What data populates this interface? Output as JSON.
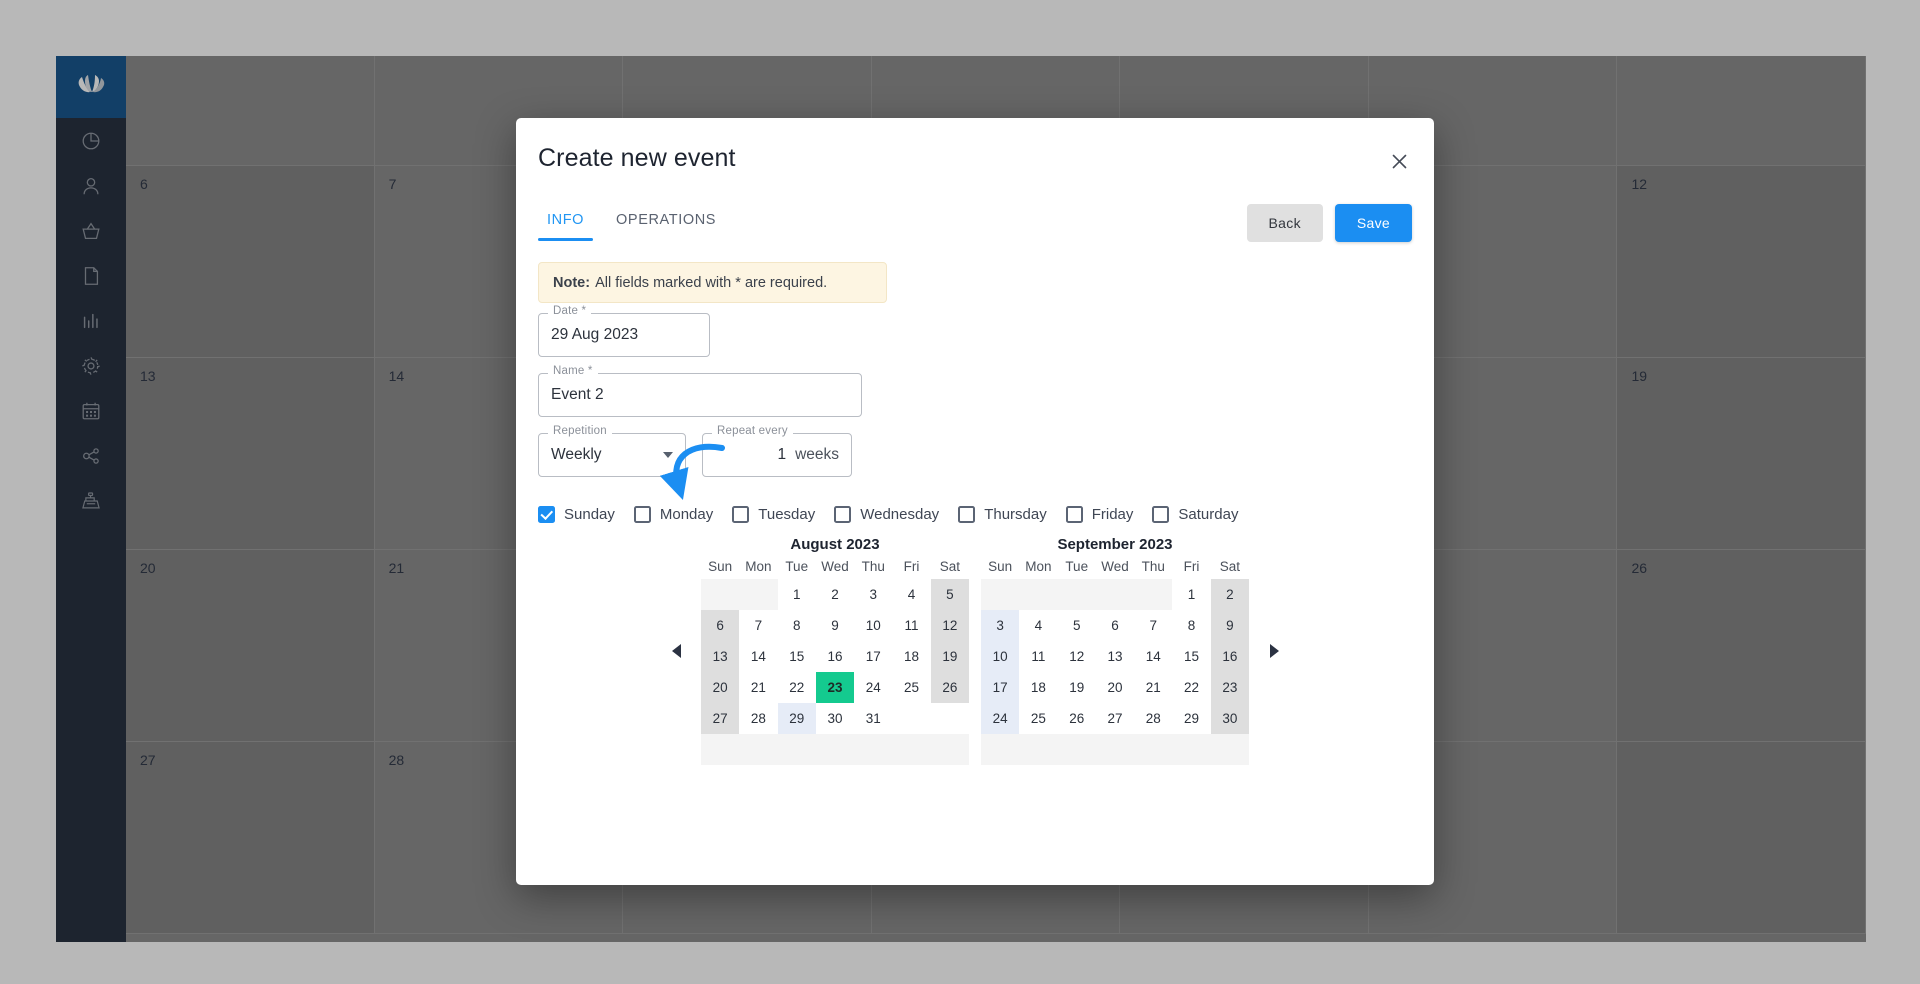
{
  "app": {
    "sidebar_items": [
      {
        "name": "logo",
        "icon": "leaf-logo-icon"
      },
      {
        "name": "dashboard",
        "icon": "pie-chart-icon"
      },
      {
        "name": "customers",
        "icon": "user-icon"
      },
      {
        "name": "orders",
        "icon": "basket-icon"
      },
      {
        "name": "documents",
        "icon": "document-icon"
      },
      {
        "name": "reports",
        "icon": "bar-chart-icon"
      },
      {
        "name": "settings",
        "icon": "gear-icon"
      },
      {
        "name": "calendar",
        "icon": "calendar-icon"
      },
      {
        "name": "integrations",
        "icon": "share-nodes-icon"
      },
      {
        "name": "register",
        "icon": "cash-register-icon"
      }
    ],
    "background_calendar": {
      "rows": [
        [
          "",
          "",
          "",
          "",
          "",
          "",
          ""
        ],
        [
          "6",
          "7",
          "",
          "",
          "",
          "",
          "12"
        ],
        [
          "13",
          "14",
          "",
          "",
          "",
          "",
          "19"
        ],
        [
          "20",
          "21",
          "",
          "",
          "",
          "",
          "26"
        ],
        [
          "27",
          "28",
          "",
          "",
          "",
          "",
          ""
        ]
      ]
    }
  },
  "modal": {
    "title": "Create new event",
    "close_label": "×",
    "tabs": [
      {
        "label": "INFO",
        "active": true
      },
      {
        "label": "OPERATIONS",
        "active": false
      }
    ],
    "buttons": {
      "back_label": "Back",
      "save_label": "Save"
    },
    "note": {
      "prefix": "Note:",
      "text": "All fields marked with * are required."
    },
    "fields": {
      "date": {
        "label": "Date *",
        "value": "29 Aug 2023"
      },
      "name": {
        "label": "Name *",
        "value": "Event 2"
      },
      "repetition": {
        "label": "Repetition",
        "value": "Weekly"
      },
      "repeat_every": {
        "label": "Repeat every",
        "value": "1",
        "unit": "weeks"
      }
    },
    "weekdays": [
      {
        "label": "Sunday",
        "checked": true
      },
      {
        "label": "Monday",
        "checked": false
      },
      {
        "label": "Tuesday",
        "checked": false
      },
      {
        "label": "Wednesday",
        "checked": false
      },
      {
        "label": "Thursday",
        "checked": false
      },
      {
        "label": "Friday",
        "checked": false
      },
      {
        "label": "Saturday",
        "checked": false
      }
    ],
    "calendars": {
      "prev_arrow": "prev-month-arrow",
      "next_arrow": "next-month-arrow",
      "day_headers": [
        "Sun",
        "Mon",
        "Tue",
        "Wed",
        "Thu",
        "Fri",
        "Sat"
      ],
      "months": [
        {
          "title": "August 2023",
          "weeks": [
            [
              {
                "d": "",
                "s": "pad"
              },
              {
                "d": "",
                "s": "pad"
              },
              {
                "d": "1",
                "s": ""
              },
              {
                "d": "2",
                "s": ""
              },
              {
                "d": "3",
                "s": ""
              },
              {
                "d": "4",
                "s": ""
              },
              {
                "d": "5",
                "s": "wk"
              }
            ],
            [
              {
                "d": "6",
                "s": "wk"
              },
              {
                "d": "7",
                "s": ""
              },
              {
                "d": "8",
                "s": ""
              },
              {
                "d": "9",
                "s": ""
              },
              {
                "d": "10",
                "s": ""
              },
              {
                "d": "11",
                "s": ""
              },
              {
                "d": "12",
                "s": "wk"
              }
            ],
            [
              {
                "d": "13",
                "s": "wk"
              },
              {
                "d": "14",
                "s": ""
              },
              {
                "d": "15",
                "s": ""
              },
              {
                "d": "16",
                "s": ""
              },
              {
                "d": "17",
                "s": ""
              },
              {
                "d": "18",
                "s": ""
              },
              {
                "d": "19",
                "s": "wk"
              }
            ],
            [
              {
                "d": "20",
                "s": "wk"
              },
              {
                "d": "21",
                "s": ""
              },
              {
                "d": "22",
                "s": ""
              },
              {
                "d": "23",
                "s": "sel"
              },
              {
                "d": "24",
                "s": ""
              },
              {
                "d": "25",
                "s": ""
              },
              {
                "d": "26",
                "s": "wk"
              }
            ],
            [
              {
                "d": "27",
                "s": "wk"
              },
              {
                "d": "28",
                "s": ""
              },
              {
                "d": "29",
                "s": "rep"
              },
              {
                "d": "30",
                "s": ""
              },
              {
                "d": "31",
                "s": ""
              },
              {
                "d": "",
                "s": "empty"
              },
              {
                "d": "",
                "s": "empty"
              }
            ]
          ]
        },
        {
          "title": "September 2023",
          "weeks": [
            [
              {
                "d": "",
                "s": "pad"
              },
              {
                "d": "",
                "s": "pad"
              },
              {
                "d": "",
                "s": "pad"
              },
              {
                "d": "",
                "s": "pad"
              },
              {
                "d": "",
                "s": "pad"
              },
              {
                "d": "1",
                "s": ""
              },
              {
                "d": "2",
                "s": "wk"
              }
            ],
            [
              {
                "d": "3",
                "s": "rep"
              },
              {
                "d": "4",
                "s": ""
              },
              {
                "d": "5",
                "s": ""
              },
              {
                "d": "6",
                "s": ""
              },
              {
                "d": "7",
                "s": ""
              },
              {
                "d": "8",
                "s": ""
              },
              {
                "d": "9",
                "s": "wk"
              }
            ],
            [
              {
                "d": "10",
                "s": "rep"
              },
              {
                "d": "11",
                "s": ""
              },
              {
                "d": "12",
                "s": ""
              },
              {
                "d": "13",
                "s": ""
              },
              {
                "d": "14",
                "s": ""
              },
              {
                "d": "15",
                "s": ""
              },
              {
                "d": "16",
                "s": "wk"
              }
            ],
            [
              {
                "d": "17",
                "s": "rep"
              },
              {
                "d": "18",
                "s": ""
              },
              {
                "d": "19",
                "s": ""
              },
              {
                "d": "20",
                "s": ""
              },
              {
                "d": "21",
                "s": ""
              },
              {
                "d": "22",
                "s": ""
              },
              {
                "d": "23",
                "s": "wk"
              }
            ],
            [
              {
                "d": "24",
                "s": "rep"
              },
              {
                "d": "25",
                "s": ""
              },
              {
                "d": "26",
                "s": ""
              },
              {
                "d": "27",
                "s": ""
              },
              {
                "d": "28",
                "s": ""
              },
              {
                "d": "29",
                "s": ""
              },
              {
                "d": "30",
                "s": "wk"
              }
            ]
          ]
        }
      ]
    }
  },
  "annotation": {
    "type": "curved-arrow",
    "target": "repetition-select",
    "color": "#1b8ef2"
  },
  "colors": {
    "accent": "#1b8ef2",
    "selected_day": "#14ca8f",
    "sidebar": "#222b3b",
    "logo_tile": "#12528c",
    "note_bg": "#fdf5e2"
  }
}
